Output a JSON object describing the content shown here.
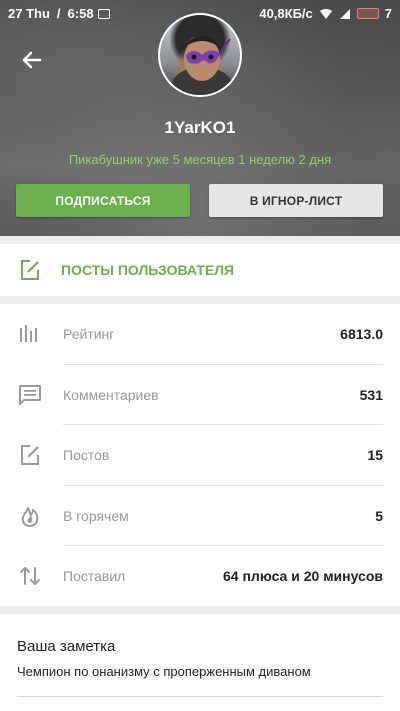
{
  "status_bar": {
    "date": "27 Thu",
    "separator": "/",
    "time": "6:58",
    "network_speed": "40,8КБ/с",
    "battery_level": "7"
  },
  "profile": {
    "username": "1YarKO1",
    "tenure": "Пикабушник уже 5 месяцев 1 неделю 2 дня",
    "subscribe_label": "ПОДПИСАТЬСЯ",
    "ignore_label": "В ИГНОР-ЛИСТ"
  },
  "posts_link": {
    "label": "ПОСТЫ ПОЛЬЗОВАТЕЛЯ"
  },
  "stats": [
    {
      "icon": "bar-chart-icon",
      "label": "Рейтинг",
      "value": "6813.0"
    },
    {
      "icon": "comment-icon",
      "label": "Комментариев",
      "value": "531"
    },
    {
      "icon": "edit-icon",
      "label": "Постов",
      "value": "15"
    },
    {
      "icon": "flame-icon",
      "label": "В горячем",
      "value": "5"
    },
    {
      "icon": "swap-vertical-icon",
      "label": "Поставил",
      "value": "64 плюса и 20 минусов"
    }
  ],
  "note": {
    "title": "Ваша заметка",
    "text": "Чемпион по онанизму с пропер­женным диваном"
  },
  "colors": {
    "accent_green": "#6ab04c",
    "tenure_green": "#8fd16a"
  }
}
